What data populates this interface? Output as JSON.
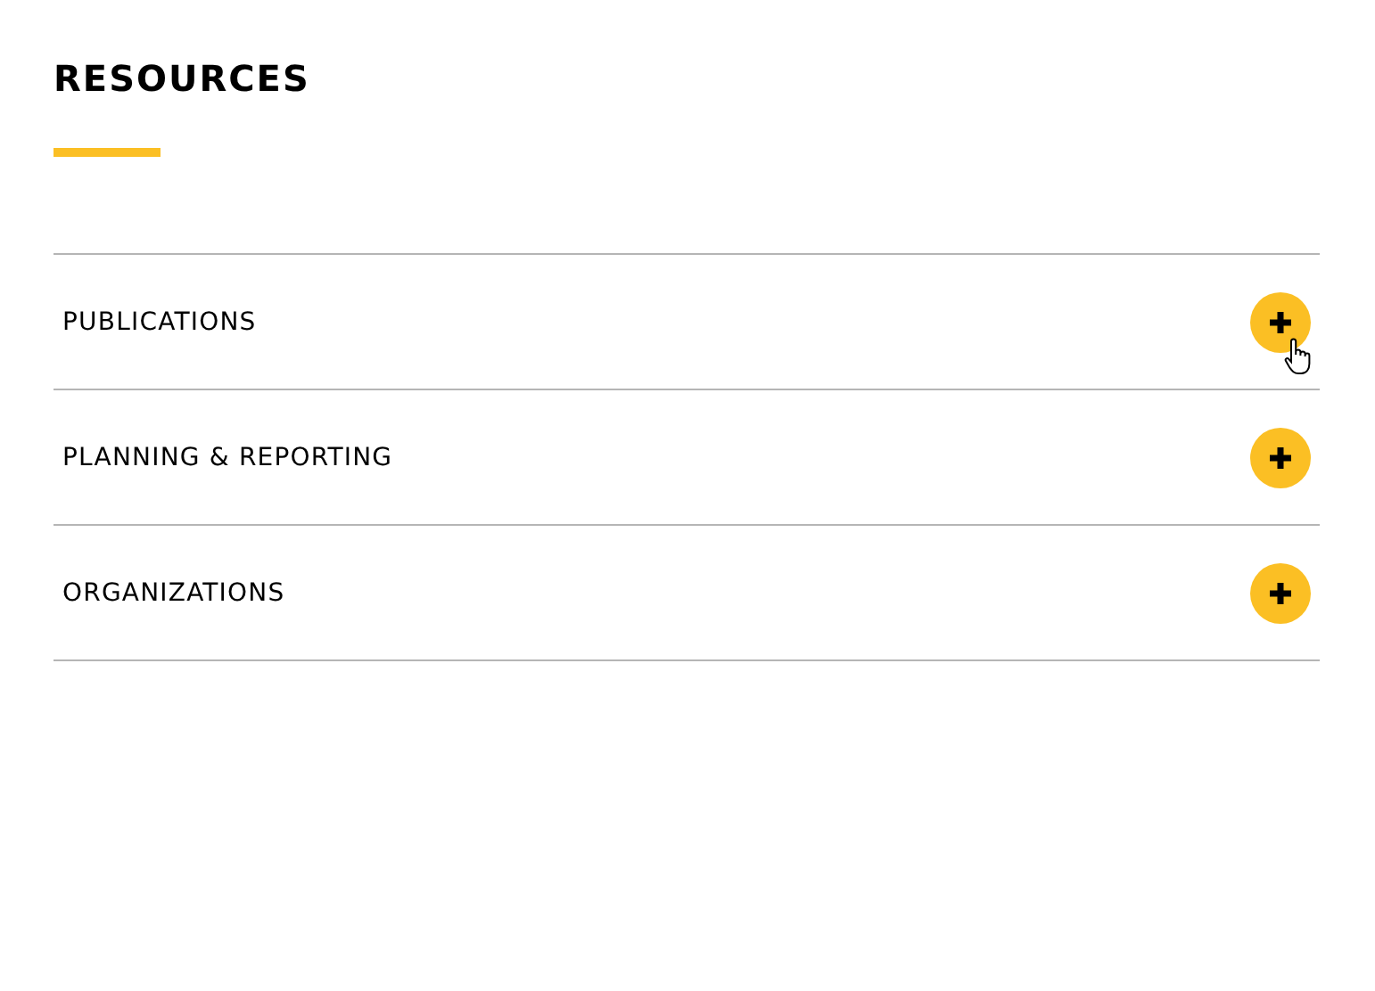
{
  "title": "RESOURCES",
  "items": [
    {
      "label": "PUBLICATIONS",
      "expanded": false,
      "hovered": true
    },
    {
      "label": "PLANNING & REPORTING",
      "expanded": false,
      "hovered": false
    },
    {
      "label": "ORGANIZATIONS",
      "expanded": false,
      "hovered": false
    }
  ]
}
